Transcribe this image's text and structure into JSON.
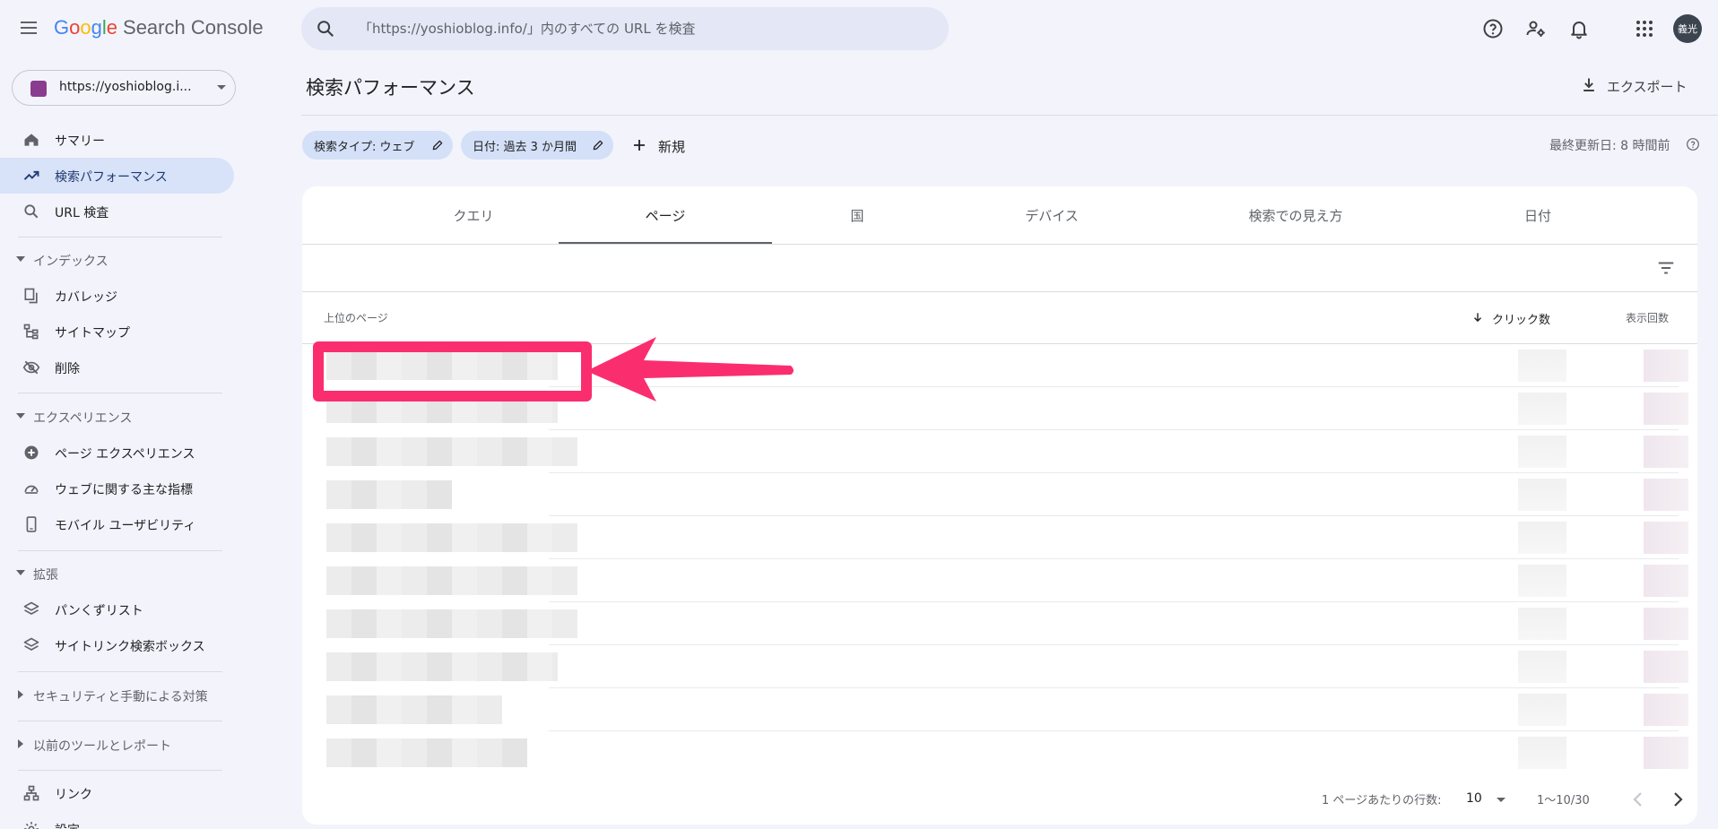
{
  "app": {
    "logo_letters": [
      "G",
      "o",
      "o",
      "g",
      "l",
      "e"
    ],
    "product": "Search Console"
  },
  "search": {
    "placeholder": "「https://yoshioblog.info/」内のすべての URL を検査"
  },
  "user": {
    "avatar_text": "義光"
  },
  "property": {
    "label": "https://yoshioblog.i..."
  },
  "sidebar": {
    "items": [
      {
        "label": "サマリー",
        "icon": "home-icon"
      },
      {
        "label": "検索パフォーマンス",
        "icon": "trending-up-icon",
        "active": true
      },
      {
        "label": "URL 検査",
        "icon": "search-icon"
      }
    ],
    "sections": [
      {
        "label": "インデックス",
        "expanded": true,
        "items": [
          {
            "label": "カバレッジ",
            "icon": "file-copy-icon"
          },
          {
            "label": "サイトマップ",
            "icon": "sitemap-icon"
          },
          {
            "label": "削除",
            "icon": "visibility-off-icon"
          }
        ]
      },
      {
        "label": "エクスペリエンス",
        "expanded": true,
        "items": [
          {
            "label": "ページ エクスペリエンス",
            "icon": "add-circle-icon"
          },
          {
            "label": "ウェブに関する主な指標",
            "icon": "speed-icon"
          },
          {
            "label": "モバイル ユーザビリティ",
            "icon": "smartphone-icon"
          }
        ]
      },
      {
        "label": "拡張",
        "expanded": true,
        "items": [
          {
            "label": "パンくずリスト",
            "icon": "layers-icon"
          },
          {
            "label": "サイトリンク検索ボックス",
            "icon": "layers-icon"
          }
        ]
      },
      {
        "label": "セキュリティと手動による対策",
        "expanded": false,
        "items": []
      },
      {
        "label": "以前のツールとレポート",
        "expanded": false,
        "items": []
      }
    ],
    "bottom_items": [
      {
        "label": "リンク",
        "icon": "link-tree-icon"
      },
      {
        "label": "設定",
        "icon": "settings-icon"
      }
    ]
  },
  "main": {
    "title": "検索パフォーマンス",
    "export_label": "エクスポート",
    "chips": {
      "type": "検索タイプ: ウェブ",
      "date": "日付: 過去 3 か月間"
    },
    "new_label": "新規",
    "last_updated": "最終更新日: 8 時間前"
  },
  "report": {
    "tabs": [
      "クエリ",
      "ページ",
      "国",
      "デバイス",
      "検索での見え方",
      "日付"
    ],
    "active_tab": "ページ",
    "columns": {
      "page": "上位のページ",
      "clicks": "クリック数",
      "impressions": "表示回数"
    },
    "pagination": {
      "rows_label": "1 ページあたりの行数:",
      "rows_value": "10",
      "range": "1〜10/30"
    }
  },
  "colors": {
    "accent": "#1a73e8",
    "highlight": "#fa2e6e",
    "active_nav": "#d8e2f8",
    "chip": "#d3e0f7"
  }
}
